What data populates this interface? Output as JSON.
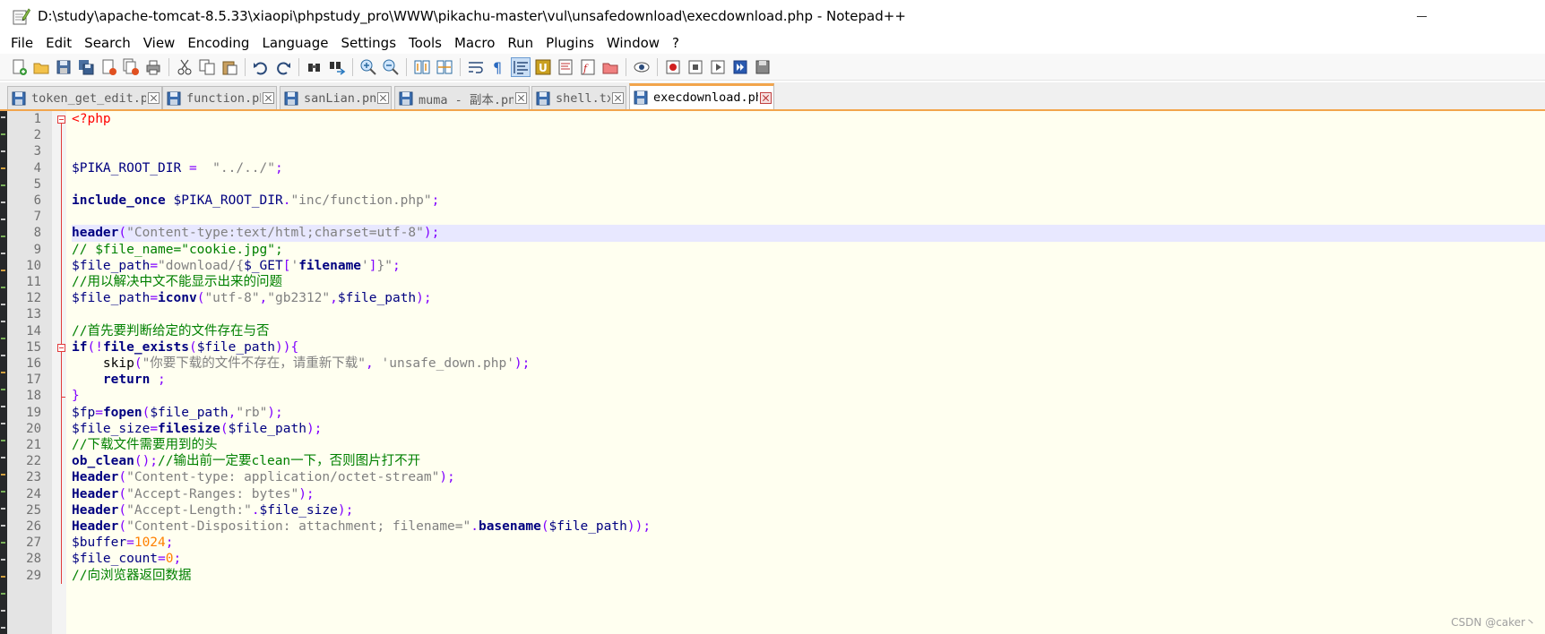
{
  "window": {
    "title": "D:\\study\\apache-tomcat-8.5.33\\xiaopi\\phpstudy_pro\\WWW\\pikachu-master\\vul\\unsafedownload\\execdownload.php - Notepad++"
  },
  "menu": [
    "File",
    "Edit",
    "Search",
    "View",
    "Encoding",
    "Language",
    "Settings",
    "Tools",
    "Macro",
    "Run",
    "Plugins",
    "Window",
    "?"
  ],
  "toolbar": {
    "buttons": [
      "new-file",
      "open-file",
      "save",
      "save-all",
      "close",
      "close-all",
      "print",
      "cut",
      "copy",
      "paste",
      "undo",
      "redo",
      "find",
      "replace",
      "zoom-in",
      "zoom-out",
      "sync-vertical",
      "sync-horizontal",
      "word-wrap",
      "show-all-characters",
      "indent-guide",
      "user-defined-language",
      "document-map",
      "function-list",
      "folder-as-workspace",
      "monitoring",
      "record-macro",
      "stop-recording",
      "play-macro",
      "run-macro-multiple",
      "save-macro"
    ]
  },
  "tabs": [
    {
      "label": "token_get_edit.php",
      "active": false
    },
    {
      "label": "function.php",
      "active": false
    },
    {
      "label": "sanLian.png",
      "active": false
    },
    {
      "label": "muma - 副本.png",
      "active": false
    },
    {
      "label": "shell.txt",
      "active": false
    },
    {
      "label": "execdownload.php",
      "active": true
    }
  ],
  "editor": {
    "current_line": 8,
    "lines": [
      {
        "n": "1",
        "fold": "start",
        "tokens": [
          [
            "tag",
            "<?php"
          ]
        ]
      },
      {
        "n": "2",
        "fold": "line",
        "tokens": []
      },
      {
        "n": "3",
        "fold": "line",
        "tokens": []
      },
      {
        "n": "4",
        "fold": "line",
        "tokens": [
          [
            "var",
            "$PIKA_ROOT_DIR"
          ],
          [
            "plain",
            " "
          ],
          [
            "op",
            "="
          ],
          [
            "plain",
            "  "
          ],
          [
            "str",
            "\"../../\""
          ],
          [
            "op",
            ";"
          ]
        ]
      },
      {
        "n": "5",
        "fold": "line",
        "tokens": []
      },
      {
        "n": "6",
        "fold": "line",
        "tokens": [
          [
            "kw",
            "include_once"
          ],
          [
            "plain",
            " "
          ],
          [
            "var",
            "$PIKA_ROOT_DIR"
          ],
          [
            "op",
            "."
          ],
          [
            "str",
            "\"inc/function.php\""
          ],
          [
            "op",
            ";"
          ]
        ]
      },
      {
        "n": "7",
        "fold": "line",
        "tokens": []
      },
      {
        "n": "8",
        "fold": "line",
        "tokens": [
          [
            "kw",
            "header"
          ],
          [
            "op",
            "("
          ],
          [
            "str",
            "\"Content-type:text/html;charset=utf-8\""
          ],
          [
            "op",
            ");"
          ]
        ]
      },
      {
        "n": "9",
        "fold": "line",
        "tokens": [
          [
            "cmt",
            "// $file_name=\"cookie.jpg\";"
          ]
        ]
      },
      {
        "n": "10",
        "fold": "line",
        "tokens": [
          [
            "var",
            "$file_path"
          ],
          [
            "op",
            "="
          ],
          [
            "str",
            "\"download/{"
          ],
          [
            "var",
            "$_GET"
          ],
          [
            "op",
            "["
          ],
          [
            "str",
            "'"
          ],
          [
            "kw",
            "filename"
          ],
          [
            "str",
            "'"
          ],
          [
            "op",
            "]"
          ],
          [
            "str",
            "}\""
          ],
          [
            "op",
            ";"
          ]
        ]
      },
      {
        "n": "11",
        "fold": "line",
        "tokens": [
          [
            "cmt",
            "//用以解决中文不能显示出来的问题"
          ]
        ]
      },
      {
        "n": "12",
        "fold": "line",
        "tokens": [
          [
            "var",
            "$file_path"
          ],
          [
            "op",
            "="
          ],
          [
            "kw",
            "iconv"
          ],
          [
            "op",
            "("
          ],
          [
            "str",
            "\"utf-8\""
          ],
          [
            "op",
            ","
          ],
          [
            "str",
            "\"gb2312\""
          ],
          [
            "op",
            ","
          ],
          [
            "var",
            "$file_path"
          ],
          [
            "op",
            ");"
          ]
        ]
      },
      {
        "n": "13",
        "fold": "line",
        "tokens": []
      },
      {
        "n": "14",
        "fold": "line",
        "tokens": [
          [
            "cmt",
            "//首先要判断给定的文件存在与否"
          ]
        ]
      },
      {
        "n": "15",
        "fold": "start",
        "tokens": [
          [
            "kw",
            "if"
          ],
          [
            "op",
            "(!"
          ],
          [
            "kw",
            "file_exists"
          ],
          [
            "op",
            "("
          ],
          [
            "var",
            "$file_path"
          ],
          [
            "op",
            ")){"
          ]
        ]
      },
      {
        "n": "16",
        "fold": "line",
        "tokens": [
          [
            "plain",
            "    "
          ],
          [
            "plain",
            "skip"
          ],
          [
            "op",
            "("
          ],
          [
            "str",
            "\"你要下载的文件不存在，请重新下载\""
          ],
          [
            "op",
            ","
          ],
          [
            "plain",
            " "
          ],
          [
            "str",
            "'unsafe_down.php'"
          ],
          [
            "op",
            ");"
          ]
        ]
      },
      {
        "n": "17",
        "fold": "line",
        "tokens": [
          [
            "plain",
            "    "
          ],
          [
            "kw",
            "return"
          ],
          [
            "plain",
            " "
          ],
          [
            "op",
            ";"
          ]
        ]
      },
      {
        "n": "18",
        "fold": "end",
        "tokens": [
          [
            "op",
            "}"
          ]
        ]
      },
      {
        "n": "19",
        "fold": "line",
        "tokens": [
          [
            "var",
            "$fp"
          ],
          [
            "op",
            "="
          ],
          [
            "kw",
            "fopen"
          ],
          [
            "op",
            "("
          ],
          [
            "var",
            "$file_path"
          ],
          [
            "op",
            ","
          ],
          [
            "str",
            "\"rb\""
          ],
          [
            "op",
            ");"
          ]
        ]
      },
      {
        "n": "20",
        "fold": "line",
        "tokens": [
          [
            "var",
            "$file_size"
          ],
          [
            "op",
            "="
          ],
          [
            "kw",
            "filesize"
          ],
          [
            "op",
            "("
          ],
          [
            "var",
            "$file_path"
          ],
          [
            "op",
            ");"
          ]
        ]
      },
      {
        "n": "21",
        "fold": "line",
        "tokens": [
          [
            "cmt",
            "//下载文件需要用到的头"
          ]
        ]
      },
      {
        "n": "22",
        "fold": "line",
        "tokens": [
          [
            "kw",
            "ob_clean"
          ],
          [
            "op",
            "();"
          ],
          [
            "cmt",
            "//输出前一定要clean一下，否则图片打不开"
          ]
        ]
      },
      {
        "n": "23",
        "fold": "line",
        "tokens": [
          [
            "kw",
            "Header"
          ],
          [
            "op",
            "("
          ],
          [
            "str",
            "\"Content-type: application/octet-stream\""
          ],
          [
            "op",
            ");"
          ]
        ]
      },
      {
        "n": "24",
        "fold": "line",
        "tokens": [
          [
            "kw",
            "Header"
          ],
          [
            "op",
            "("
          ],
          [
            "str",
            "\"Accept-Ranges: bytes\""
          ],
          [
            "op",
            ");"
          ]
        ]
      },
      {
        "n": "25",
        "fold": "line",
        "tokens": [
          [
            "kw",
            "Header"
          ],
          [
            "op",
            "("
          ],
          [
            "str",
            "\"Accept-Length:\""
          ],
          [
            "op",
            "."
          ],
          [
            "var",
            "$file_size"
          ],
          [
            "op",
            ");"
          ]
        ]
      },
      {
        "n": "26",
        "fold": "line",
        "tokens": [
          [
            "kw",
            "Header"
          ],
          [
            "op",
            "("
          ],
          [
            "str",
            "\"Content-Disposition: attachment; filename=\""
          ],
          [
            "op",
            "."
          ],
          [
            "kw",
            "basename"
          ],
          [
            "op",
            "("
          ],
          [
            "var",
            "$file_path"
          ],
          [
            "op",
            "));"
          ]
        ]
      },
      {
        "n": "27",
        "fold": "line",
        "tokens": [
          [
            "var",
            "$buffer"
          ],
          [
            "op",
            "="
          ],
          [
            "num",
            "1024"
          ],
          [
            "op",
            ";"
          ]
        ]
      },
      {
        "n": "28",
        "fold": "line",
        "tokens": [
          [
            "var",
            "$file_count"
          ],
          [
            "op",
            "="
          ],
          [
            "num",
            "0"
          ],
          [
            "op",
            ";"
          ]
        ]
      },
      {
        "n": "29",
        "fold": "line",
        "tokens": [
          [
            "cmt",
            "//向浏览器返回数据"
          ]
        ]
      }
    ]
  },
  "watermark": "CSDN @caker丶",
  "colors": {
    "tag": "#ff0000",
    "variable": "#000080",
    "operator": "#8000ff",
    "string": "#808080",
    "keyword": "#000080",
    "comment": "#008000",
    "number": "#ff8000",
    "editor_bg": "#fffff0",
    "current_line": "#e8e8ff",
    "tab_accent": "#f2a54c"
  }
}
